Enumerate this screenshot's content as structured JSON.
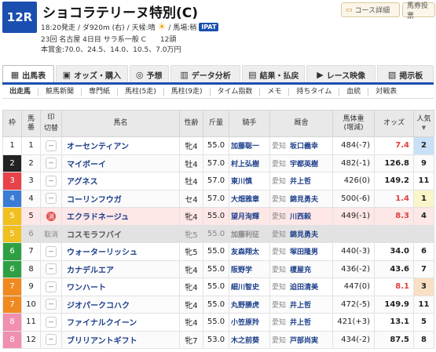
{
  "race": {
    "number": "12R",
    "title": "ショコラテリーヌ特別(C)",
    "post_time": "18:20発走",
    "course": "/ ダ920m (右)",
    "weather_label": "/ 天候:晴",
    "track": "/ 馬場:稍",
    "ipat": "IPAT",
    "meta": "23回 名古屋 4日目 サラ系一般 C　　12頭",
    "prize": "本賞金:70.0、24.5、14.0、10.5、7.0万円"
  },
  "header_buttons": {
    "course_detail": "コース詳細",
    "horse_bet": "馬券投票"
  },
  "tabs": [
    {
      "label": "出馬表",
      "icon": "▦"
    },
    {
      "label": "オッズ・購入",
      "icon": "▣"
    },
    {
      "label": "予想",
      "icon": "◎"
    },
    {
      "label": "データ分析",
      "icon": "▥"
    },
    {
      "label": "結果・払戻",
      "icon": "▤"
    },
    {
      "label": "レース映像",
      "icon": "▶"
    },
    {
      "label": "掲示板",
      "icon": "▧"
    }
  ],
  "subnav": [
    "出走馬",
    "競馬新聞",
    "専門紙",
    "馬柱(5走)",
    "馬柱(9走)",
    "タイム指数",
    "メモ",
    "持ちタイム",
    "血統",
    "対戦表"
  ],
  "table_headers": {
    "waku": "枠",
    "umaban": "馬\n番",
    "mark": "印",
    "kirikae": "切替",
    "horse": "馬名",
    "sex_age": "性齢",
    "weight": "斤量",
    "jockey": "騎手",
    "trainer": "厩舎",
    "body_weight": "馬体重\n(増減)",
    "odds": "オッズ",
    "popularity": "人気",
    "pop_arrow": "▼"
  },
  "colors": {
    "waku": [
      "",
      "#ffffff",
      "#222222",
      "#e8424a",
      "#3a7bd5",
      "#f0c020",
      "#2ea043",
      "#f08a20",
      "#f08fb0"
    ],
    "brand_blue": "#1a4fb0"
  },
  "runners": [
    {
      "waku": "1",
      "num": "1",
      "mark": "--",
      "name": "オーセンティアン",
      "sex_age": "牝4",
      "weight": "55.0",
      "jockey": "加藤聡一",
      "loc": "愛知",
      "trainer": "坂口義幸",
      "bw": "484(-7)",
      "odds": "7.4",
      "pop": "2"
    },
    {
      "waku": "2",
      "num": "2",
      "mark": "--",
      "name": "マイボーイ",
      "sex_age": "牡4",
      "weight": "57.0",
      "jockey": "村上弘樹",
      "loc": "愛知",
      "trainer": "宇都英樹",
      "bw": "482(-1)",
      "odds": "126.8",
      "pop": "9"
    },
    {
      "waku": "3",
      "num": "3",
      "mark": "--",
      "name": "アグネス",
      "sex_age": "牡4",
      "weight": "57.0",
      "jockey": "東川慎",
      "loc": "愛知",
      "trainer": "井上哲",
      "bw": "426(0)",
      "odds": "149.2",
      "pop": "11"
    },
    {
      "waku": "4",
      "num": "4",
      "mark": "--",
      "name": "コーリンフウガ",
      "sex_age": "セ4",
      "weight": "57.0",
      "jockey": "大畑雅章",
      "loc": "愛知",
      "trainer": "錦見勇夫",
      "bw": "500(-6)",
      "odds": "1.4",
      "pop": "1"
    },
    {
      "waku": "5",
      "num": "5",
      "mark": "消",
      "name": "エクラドネージュ",
      "sex_age": "牝4",
      "weight": "55.0",
      "jockey": "望月洵輝",
      "loc": "愛知",
      "trainer": "川西毅",
      "bw": "449(-1)",
      "odds": "8.3",
      "pop": "4"
    },
    {
      "waku": "5",
      "num": "6",
      "mark": "取消",
      "name": "コスモラフバイ",
      "sex_age": "牝5",
      "weight": "55.0",
      "jockey": "加藤利征",
      "loc": "愛知",
      "trainer": "錦見勇夫",
      "bw": "",
      "odds": "",
      "pop": ""
    },
    {
      "waku": "6",
      "num": "7",
      "mark": "--",
      "name": "ウォーターリッシュ",
      "sex_age": "牝5",
      "weight": "55.0",
      "jockey": "友森翔太",
      "loc": "愛知",
      "trainer": "塚田隆男",
      "bw": "440(-3)",
      "odds": "34.0",
      "pop": "6"
    },
    {
      "waku": "6",
      "num": "8",
      "mark": "--",
      "name": "カナデルエア",
      "sex_age": "牝4",
      "weight": "55.0",
      "jockey": "阪野学",
      "loc": "愛知",
      "trainer": "榎屋充",
      "bw": "436(-2)",
      "odds": "43.6",
      "pop": "7"
    },
    {
      "waku": "7",
      "num": "9",
      "mark": "--",
      "name": "ワンハート",
      "sex_age": "牝4",
      "weight": "55.0",
      "jockey": "細川智史",
      "loc": "愛知",
      "trainer": "迫田清美",
      "bw": "447(0)",
      "odds": "8.1",
      "pop": "3"
    },
    {
      "waku": "7",
      "num": "10",
      "mark": "--",
      "name": "ジオパークコハク",
      "sex_age": "牝4",
      "weight": "55.0",
      "jockey": "丸野勝虎",
      "loc": "愛知",
      "trainer": "井上哲",
      "bw": "472(-5)",
      "odds": "149.9",
      "pop": "11"
    },
    {
      "waku": "8",
      "num": "11",
      "mark": "--",
      "name": "ファイナルクイーン",
      "sex_age": "牝4",
      "weight": "55.0",
      "jockey": "小笠原羚",
      "loc": "愛知",
      "trainer": "井上哲",
      "bw": "421(+3)",
      "odds": "13.1",
      "pop": "5"
    },
    {
      "waku": "8",
      "num": "12",
      "mark": "--",
      "name": "ブリリアントギフト",
      "sex_age": "牝7",
      "weight": "53.0",
      "jockey": "木之前葵",
      "loc": "愛知",
      "trainer": "戸部尚実",
      "bw": "434(-2)",
      "odds": "87.5",
      "pop": "8"
    }
  ]
}
